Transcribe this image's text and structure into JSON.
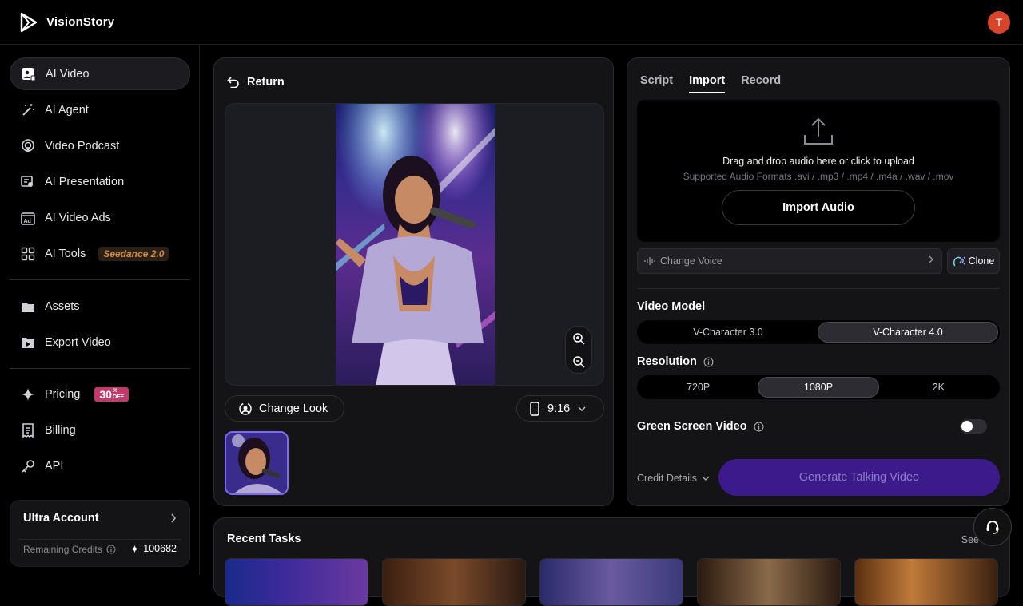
{
  "app": {
    "name": "VisionStory",
    "user_initial": "T"
  },
  "sidebar": {
    "items": [
      {
        "label": "AI Video",
        "icon": "ai-video-icon",
        "active": true
      },
      {
        "label": "AI Agent",
        "icon": "magic-wand-icon"
      },
      {
        "label": "Video Podcast",
        "icon": "podcast-icon"
      },
      {
        "label": "AI Presentation",
        "icon": "presentation-icon"
      },
      {
        "label": "AI Video Ads",
        "icon": "ads-icon"
      },
      {
        "label": "AI Tools",
        "icon": "grid-icon",
        "badge": "Seedance 2.0"
      },
      {
        "label": "Assets",
        "icon": "folder-icon"
      },
      {
        "label": "Export Video",
        "icon": "export-video-icon"
      },
      {
        "label": "Pricing",
        "icon": "sparkle-icon",
        "badge_main": "30",
        "badge_pct": "%",
        "badge_off": "OFF"
      },
      {
        "label": "Billing",
        "icon": "receipt-icon"
      },
      {
        "label": "API",
        "icon": "key-icon"
      }
    ],
    "account": {
      "title": "Ultra Account",
      "remaining_label": "Remaining Credits",
      "credits": "100682"
    }
  },
  "editor": {
    "return_label": "Return",
    "change_look_label": "Change Look",
    "aspect_ratio": "9:16"
  },
  "audio": {
    "tabs": [
      "Script",
      "Import",
      "Record"
    ],
    "active_tab": "Import",
    "drop_text": "Drag and drop audio here or click to upload",
    "formats_text": "Supported Audio Formats .avi / .mp3 / .mp4 / .m4a / .wav / .mov",
    "import_button": "Import Audio",
    "change_voice_placeholder": "Change Voice",
    "clone_label": "Clone",
    "video_model_label": "Video Model",
    "models": [
      "V-Character 3.0",
      "V-Character 4.0"
    ],
    "selected_model": "V-Character 4.0",
    "resolution_label": "Resolution",
    "resolutions": [
      "720P",
      "1080P",
      "2K"
    ],
    "selected_resolution": "1080P",
    "green_screen_label": "Green Screen Video",
    "green_screen_on": false,
    "credit_details_label": "Credit Details",
    "generate_button": "Generate Talking Video"
  },
  "tasks": {
    "title": "Recent Tasks",
    "see_all": "See"
  },
  "colors": {
    "accent": "#3d1a8c",
    "thumb_border": "#7d6cf0",
    "avatar": "#d9452b",
    "badge": "#c03a6a"
  }
}
